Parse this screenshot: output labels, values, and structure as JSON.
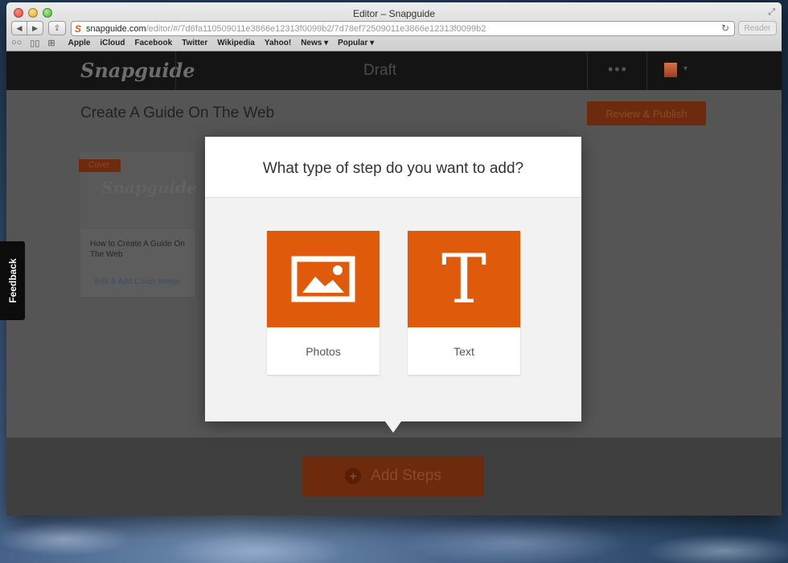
{
  "window": {
    "title": "Editor – Snapguide",
    "url_host": "snapguide.com",
    "url_path": "/editor/#/7d6fa110509011e3866e12313f0099b2/7d78ef72509011e3866e12313f0099b2",
    "reader_label": "Reader",
    "favicon_letter": "S"
  },
  "bookmarks": [
    "Apple",
    "iCloud",
    "Facebook",
    "Twitter",
    "Wikipedia",
    "Yahoo!",
    "News ▾",
    "Popular ▾"
  ],
  "header": {
    "logo": "Snapguide",
    "status": "Draft",
    "more_glyph": "•••",
    "caret": "▾"
  },
  "editor": {
    "guide_title": "Create A Guide On The Web",
    "review_button": "Review & Publish",
    "cover": {
      "tag": "Cover",
      "logo": "Snapguide",
      "caption": "How to Create A Guide On The Web",
      "link": "Edit & Add Cover Image"
    },
    "add_steps_button": "Add Steps",
    "plus_glyph": "+"
  },
  "feedback_label": "Feedback",
  "modal": {
    "title": "What type of step do you want to add?",
    "options": [
      {
        "label": "Photos",
        "icon": "photo-icon"
      },
      {
        "label": "Text",
        "icon": "text-icon",
        "glyph": "T"
      }
    ]
  },
  "colors": {
    "accent": "#e05a0c",
    "header_bg": "#141414"
  }
}
